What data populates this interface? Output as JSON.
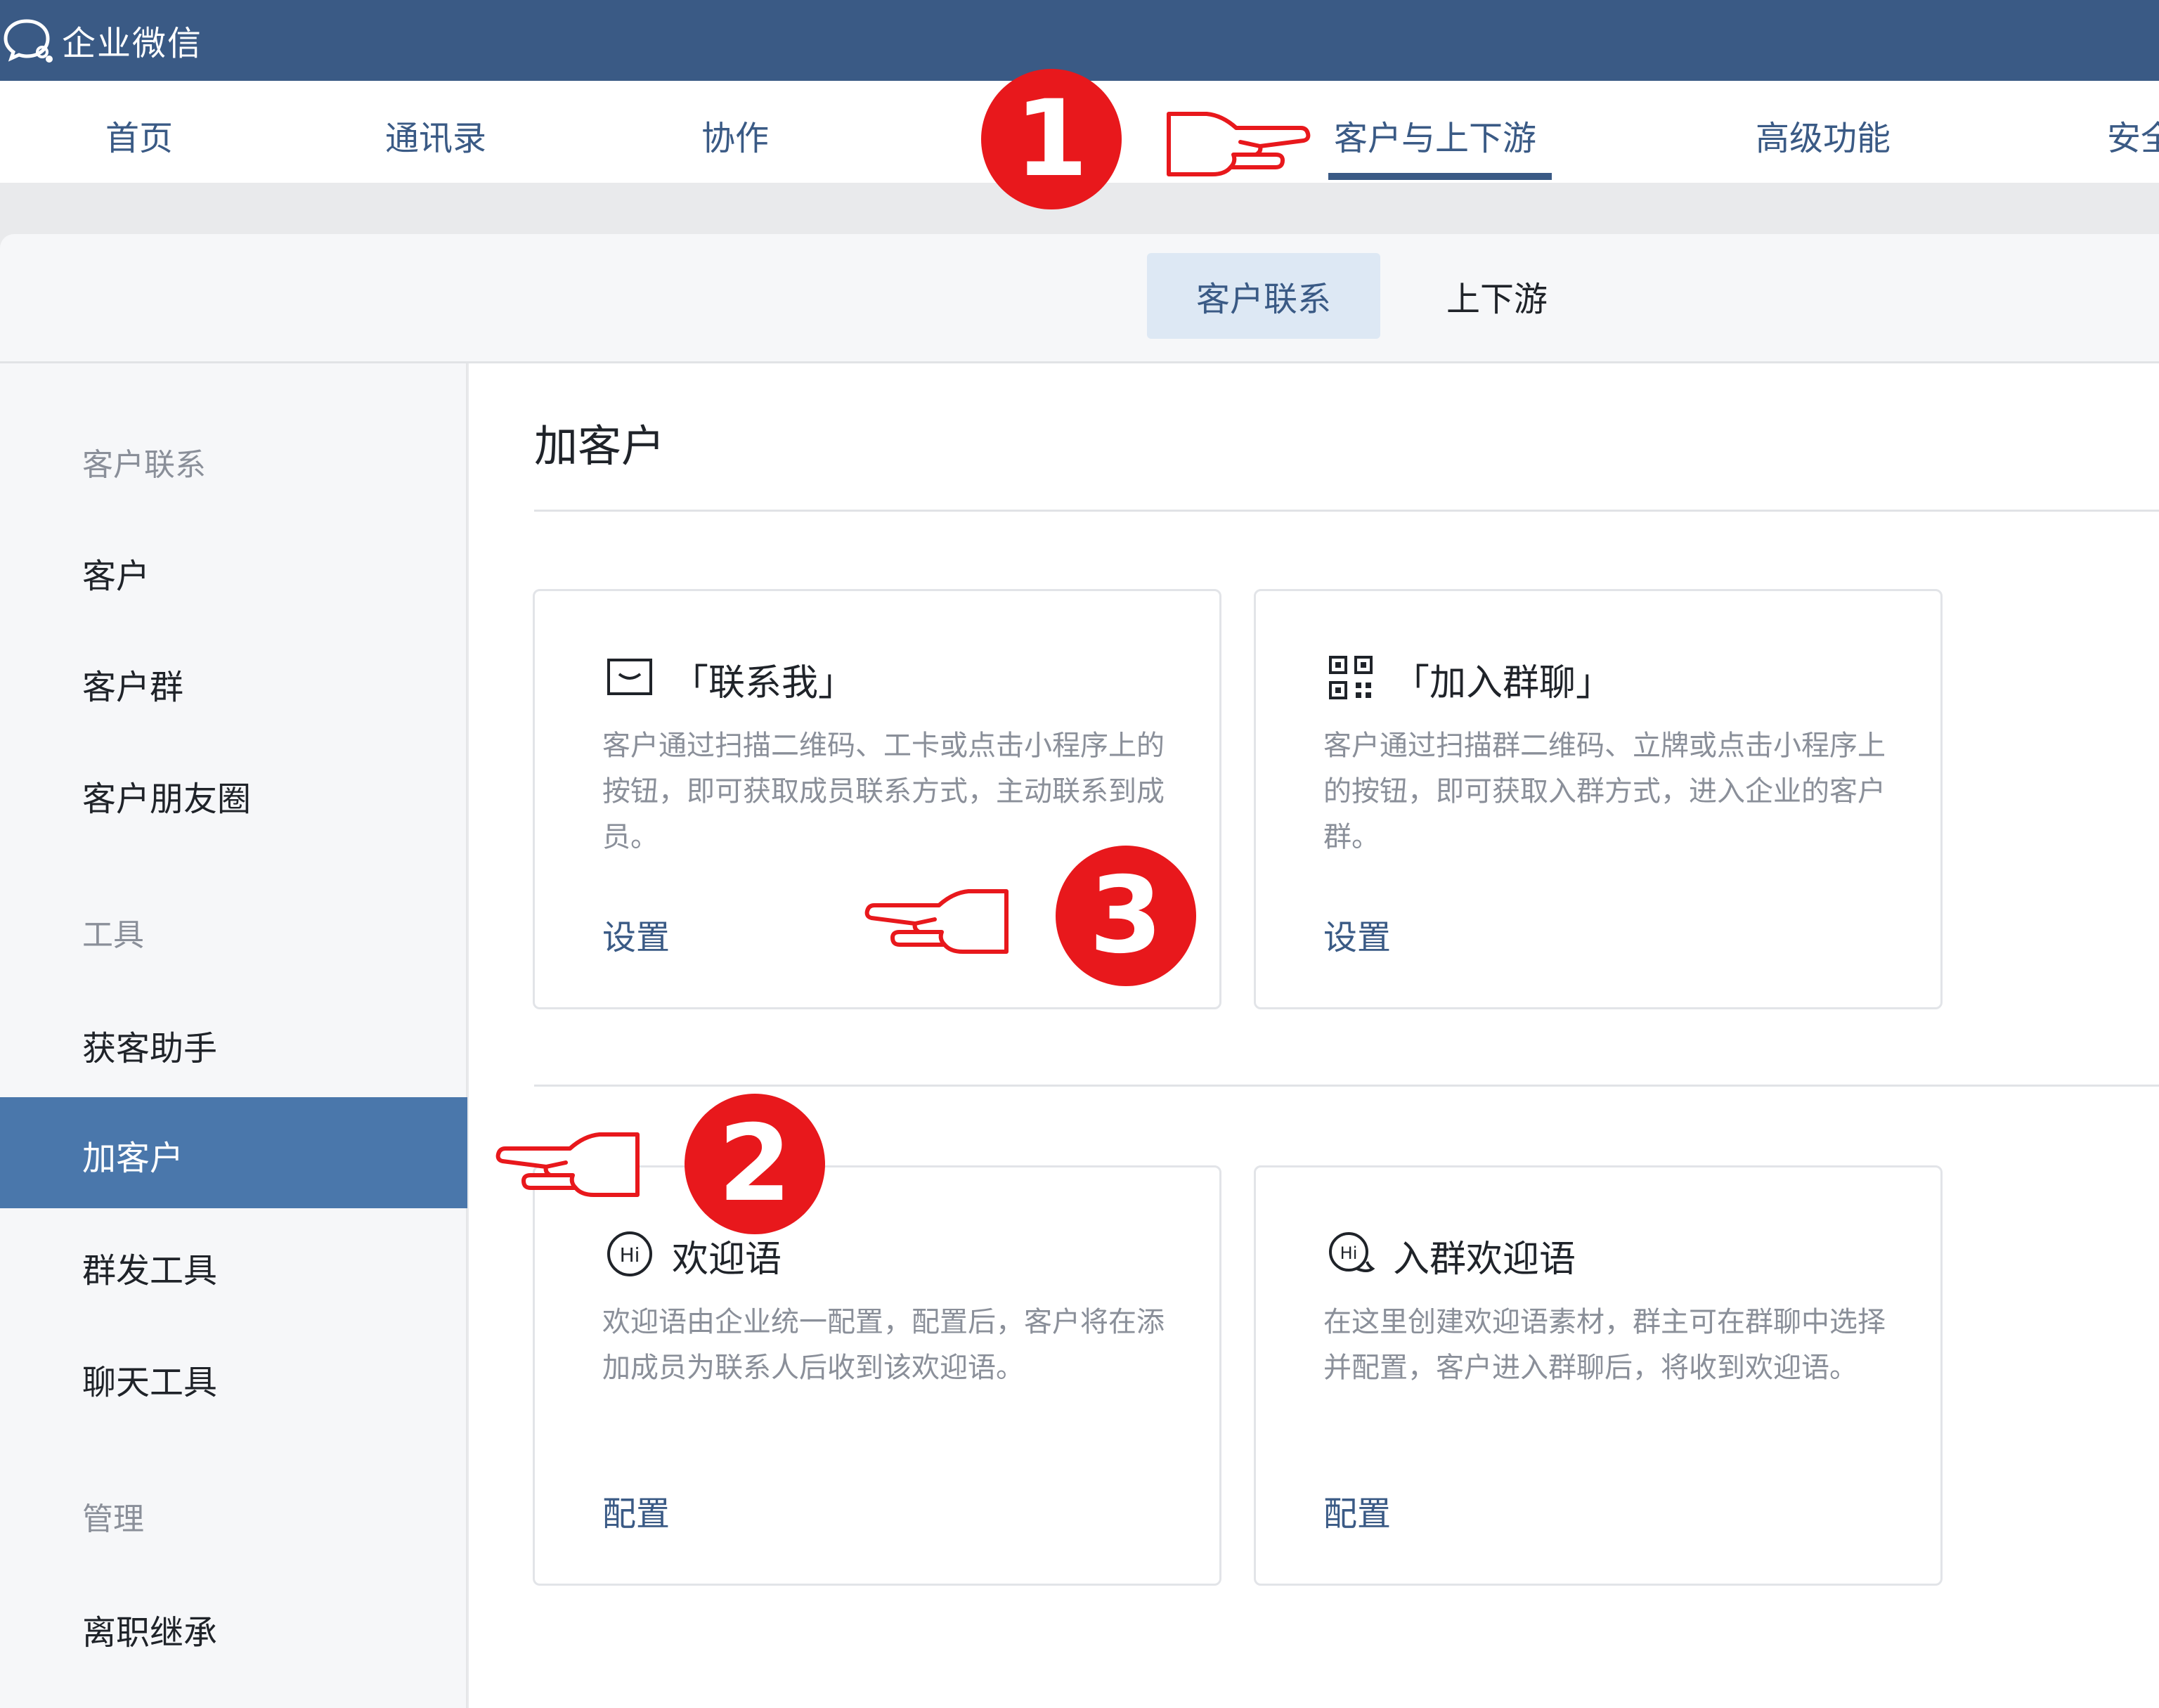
{
  "app": {
    "name": "企业微信",
    "logo_icon": "wecom-logo-icon"
  },
  "main_nav": {
    "items": [
      {
        "label": "首页"
      },
      {
        "label": "通讯录"
      },
      {
        "label": "协作"
      },
      {
        "label": "客户与上下游",
        "active": true
      },
      {
        "label": "高级功能"
      },
      {
        "label": "安全"
      }
    ]
  },
  "sub_tabs": [
    {
      "label": "客户联系",
      "active": true
    },
    {
      "label": "上下游"
    }
  ],
  "sidebar": {
    "groups": [
      {
        "title": "客户联系",
        "items": [
          "客户",
          "客户群",
          "客户朋友圈"
        ]
      },
      {
        "title": "工具",
        "items": [
          "获客助手",
          "加客户",
          "群发工具",
          "聊天工具"
        ]
      },
      {
        "title": "管理",
        "items": [
          "离职继承"
        ]
      }
    ],
    "active_item": "加客户"
  },
  "page": {
    "title": "加客户",
    "cards": [
      {
        "icon": "message-card-icon",
        "title": "「联系我」",
        "desc": "客户通过扫描二维码、工卡或点击小程序上的按钮，即可获取成员联系方式，主动联系到成员。",
        "link": "设置"
      },
      {
        "icon": "qr-code-icon",
        "title": "「加入群聊」",
        "desc": "客户通过扫描群二维码、立牌或点击小程序上的按钮，即可获取入群方式，进入企业的客户群。",
        "link": "设置"
      },
      {
        "icon": "hi-greeting-icon",
        "title": "欢迎语",
        "desc": "欢迎语由企业统一配置，配置后，客户将在添加成员为联系人后收到该欢迎语。",
        "link": "配置"
      },
      {
        "icon": "hi-chat-bubble-icon",
        "title": "入群欢迎语",
        "desc": "在这里创建欢迎语素材，群主可在群聊中选择并配置，客户进入群聊后，将收到欢迎语。",
        "link": "配置"
      }
    ]
  },
  "annotations": {
    "step1": "1",
    "step2": "2",
    "step3": "3",
    "badge_color": "#e8181c"
  },
  "colors": {
    "topbar": "#3a5a85",
    "accent": "#3a5a85",
    "sidebar_active": "#4a77ab"
  }
}
